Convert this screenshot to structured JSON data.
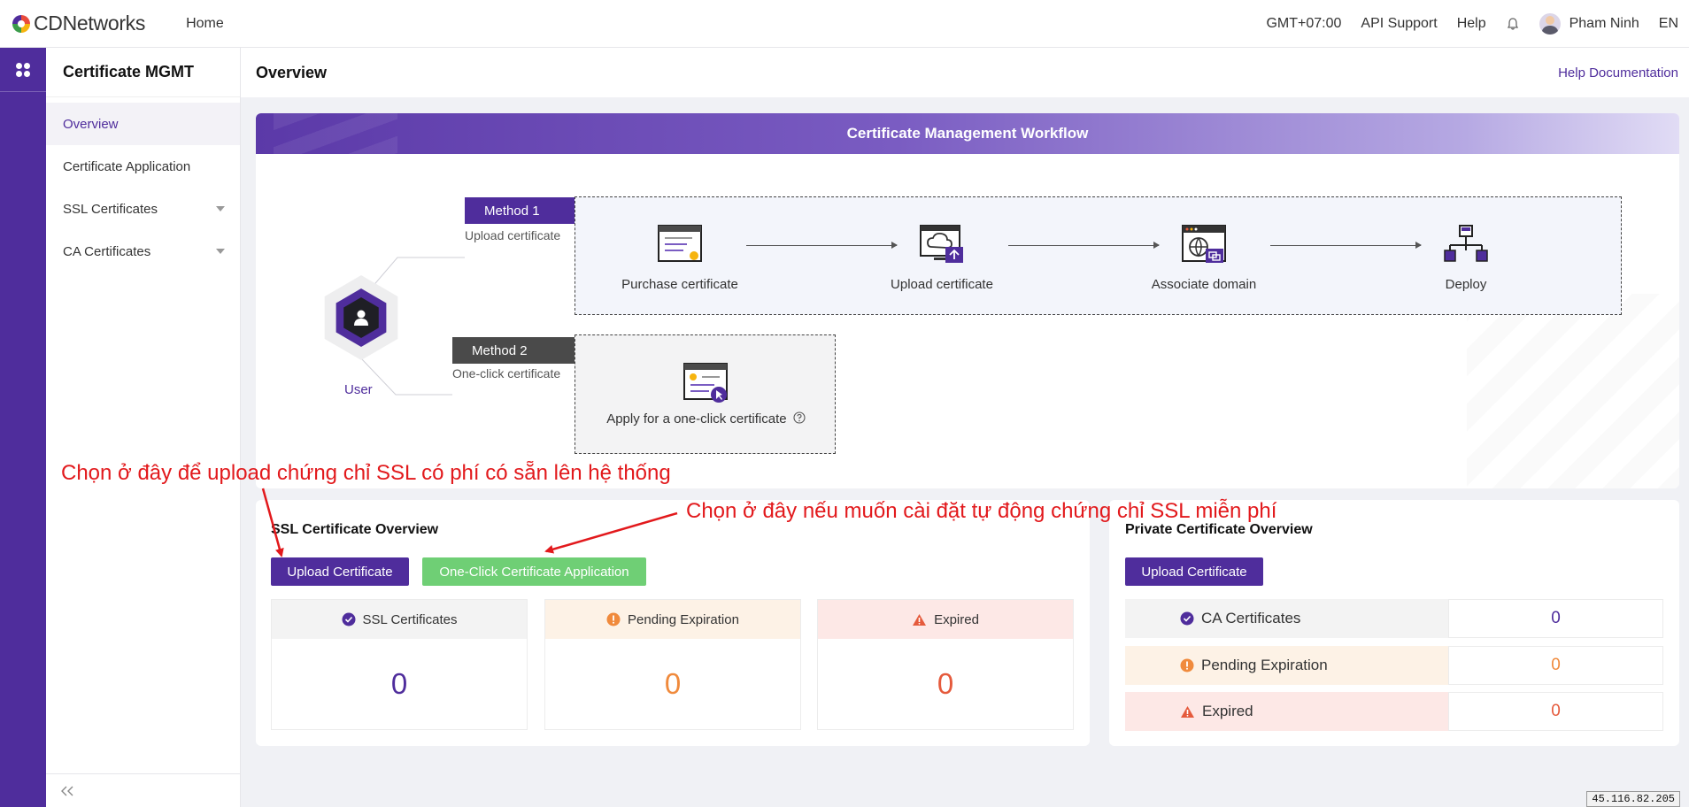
{
  "topbar": {
    "brand": "CDNetworks",
    "home": "Home",
    "timezone": "GMT+07:00",
    "api_support": "API Support",
    "help": "Help",
    "user_name": "Pham Ninh",
    "language": "EN"
  },
  "sidebar": {
    "title": "Certificate MGMT",
    "items": [
      {
        "label": "Overview",
        "active": true
      },
      {
        "label": "Certificate Application"
      },
      {
        "label": "SSL Certificates",
        "expandable": true
      },
      {
        "label": "CA Certificates",
        "expandable": true
      }
    ],
    "collapse_icon": "double-chevron-left-icon"
  },
  "page": {
    "title": "Overview",
    "help_doc": "Help Documentation"
  },
  "workflow": {
    "title": "Certificate Management Workflow",
    "user_label": "User",
    "method1": {
      "tag": "Method 1",
      "subtitle": "Upload certificate"
    },
    "method2": {
      "tag": "Method 2",
      "subtitle": "One-click certificate"
    },
    "steps": [
      {
        "label": "Purchase certificate",
        "icon": "certificate-doc-icon"
      },
      {
        "label": "Upload certificate",
        "icon": "upload-cloud-icon"
      },
      {
        "label": "Associate domain",
        "icon": "globe-browser-icon"
      },
      {
        "label": "Deploy",
        "icon": "network-tree-icon"
      }
    ],
    "oneclick_label": "Apply for a one-click certificate"
  },
  "ssl_overview": {
    "title": "SSL Certificate Overview",
    "upload_button": "Upload Certificate",
    "oneclick_button": "One-Click Certificate Application",
    "stats": [
      {
        "label": "SSL Certificates",
        "value": "0",
        "color": "#4f2d9c",
        "bg": "#f3f3f3"
      },
      {
        "label": "Pending Expiration",
        "value": "0",
        "color": "#f08a3c",
        "bg": "#fdf2e6"
      },
      {
        "label": "Expired",
        "value": "0",
        "color": "#e55a3c",
        "bg": "#fde8e6"
      }
    ]
  },
  "private_overview": {
    "title": "Private Certificate Overview",
    "upload_button": "Upload Certificate",
    "rows": [
      {
        "label": "CA Certificates",
        "value": "0",
        "color": "#4f2d9c",
        "bg": "#f3f3f3"
      },
      {
        "label": "Pending Expiration",
        "value": "0",
        "color": "#f08a3c",
        "bg": "#fdf2e6"
      },
      {
        "label": "Expired",
        "value": "0",
        "color": "#e55a3c",
        "bg": "#fde8e6"
      }
    ]
  },
  "annotations": {
    "upload_note": "Chọn ở đây để upload chứng chỉ SSL có phí có sẵn lên hệ thống",
    "oneclick_note": "Chọn ở đây nếu muốn cài đặt tự động chứng chỉ SSL miễn phí"
  },
  "ip_badge": "45.116.82.205",
  "colors": {
    "brand_purple": "#4f2d9c",
    "green": "#6fcf75",
    "annotation_red": "#e2191c"
  }
}
